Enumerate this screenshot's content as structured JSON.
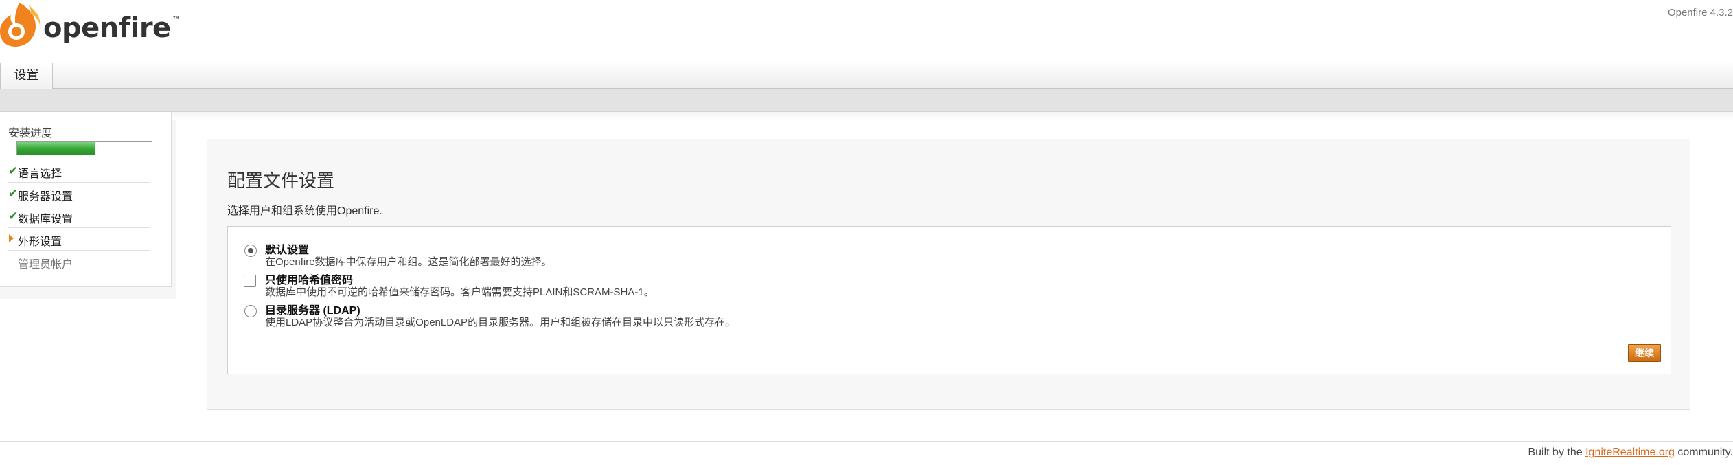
{
  "header": {
    "logo_text": "openfire",
    "logo_tm": "™",
    "version": "Openfire 4.3.2"
  },
  "tabs": [
    {
      "label": "设置"
    }
  ],
  "sidebar": {
    "progress_label": "安装进度",
    "progress_fraction": 0.58,
    "steps": [
      {
        "label": "语言选择",
        "status": "done"
      },
      {
        "label": "服务器设置",
        "status": "done"
      },
      {
        "label": "数据库设置",
        "status": "done"
      },
      {
        "label": "外形设置",
        "status": "current"
      },
      {
        "label": "管理员帐户",
        "status": "pending"
      }
    ]
  },
  "main": {
    "title": "配置文件设置",
    "description": "选择用户和组系统使用Openfire.",
    "options": [
      {
        "type": "radio",
        "checked": true,
        "title": "默认设置",
        "desc": "在Openfire数据库中保存用户和组。这是简化部署最好的选择。"
      },
      {
        "type": "checkbox",
        "checked": false,
        "title": "只使用哈希值密码",
        "desc": "数据库中使用不可逆的哈希值来储存密码。客户端需要支持PLAIN和SCRAM-SHA-1。"
      },
      {
        "type": "radio",
        "checked": false,
        "title": "目录服务器 (LDAP)",
        "desc": "使用LDAP协议整合为活动目录或OpenLDAP的目录服务器。用户和组被存储在目录中以只读形式存在。"
      }
    ],
    "continue_label": "继续"
  },
  "footer": {
    "prefix": "Built by the ",
    "link": "IgniteRealtime.org",
    "suffix": " community."
  },
  "colors": {
    "accent_orange": "#d9691a",
    "check_green": "#2e8b2e",
    "progress_green": "#35a635"
  }
}
